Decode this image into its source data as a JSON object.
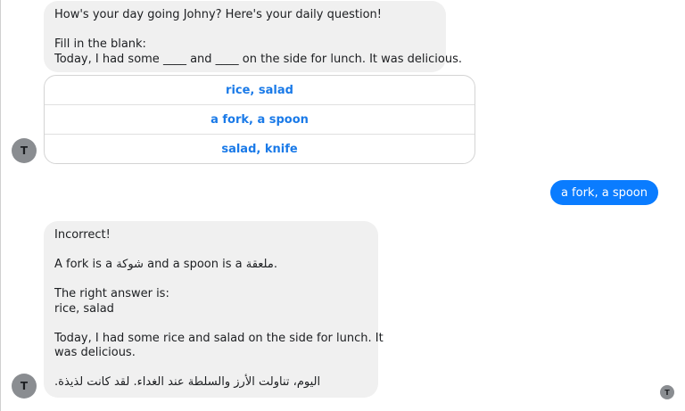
{
  "messages": {
    "question": {
      "greeting": "How's your day going Johny? Here's your daily question!",
      "instruction": "Fill in the blank:",
      "sentence": "Today, I had some ____ and ____ on the side for lunch. It was delicious."
    },
    "quick_replies": [
      "rice, salad",
      "a fork, a spoon",
      "salad, knife"
    ],
    "user_reply": "a fork, a spoon",
    "feedback": {
      "verdict": "Incorrect!",
      "vocab_prefix": "A fork is a ",
      "vocab_word1": "شوكة",
      "vocab_middle": " and a spoon is a ",
      "vocab_word2": "ملعقة",
      "vocab_suffix": ".",
      "answer_label": "The right answer is:",
      "answer_value": "rice, salad",
      "completed_line1": "Today, I had some rice and salad on the side for lunch. It",
      "completed_line2": "was delicious.",
      "arabic_translation": "اليوم، تناولت الأرز والسلطة عند الغداء. لقد كانت لذيذة."
    }
  },
  "avatar_initial": "T",
  "colors": {
    "outgoing_bubble": "#0a7cff",
    "incoming_bubble": "#f0f0f0",
    "quick_reply_text": "#1a7ae8",
    "avatar": "#8a8d91"
  }
}
